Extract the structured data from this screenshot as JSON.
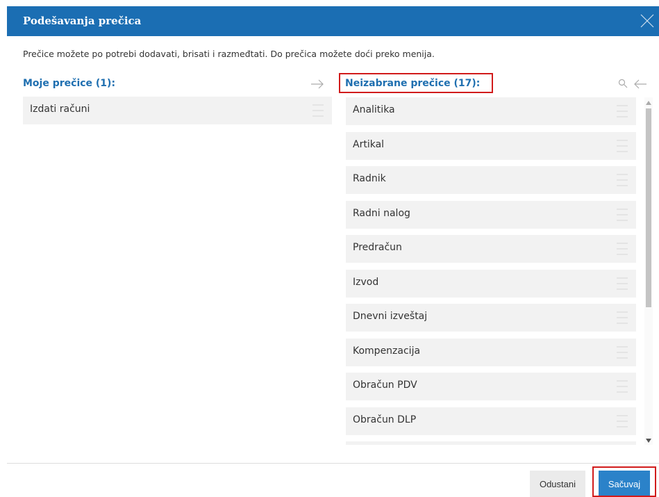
{
  "dialog": {
    "title": "Podešavanja prečica",
    "description": "Prečice možete po potrebi dodavati, brisati i razmeđtati. Do prečica možete doći preko menija."
  },
  "my_shortcuts": {
    "heading": "Moje prečice (1):",
    "items": [
      {
        "label": "Izdati računi"
      }
    ]
  },
  "unselected_shortcuts": {
    "heading": "Neizabrane prečice (17):",
    "items": [
      {
        "label": "Analitika"
      },
      {
        "label": "Artikal"
      },
      {
        "label": "Radnik"
      },
      {
        "label": "Radni nalog"
      },
      {
        "label": "Predračun"
      },
      {
        "label": "Izvod"
      },
      {
        "label": "Dnevni izveštaj"
      },
      {
        "label": "Kompenzacija"
      },
      {
        "label": "Obračun PDV"
      },
      {
        "label": "Obračun DLP"
      }
    ]
  },
  "footer": {
    "cancel_label": "Odustani",
    "save_label": "Sačuvaj"
  },
  "colors": {
    "titlebar": "#1b6eb3",
    "accent_text": "#1f6fb0",
    "highlight": "#d11b1b",
    "save_button": "#2b82c9"
  }
}
